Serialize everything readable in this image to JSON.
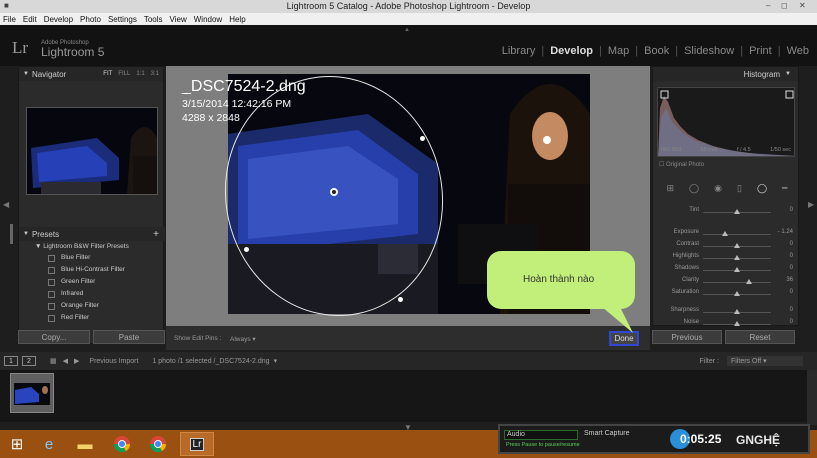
{
  "window": {
    "title": "Lightroom 5 Catalog - Adobe Photoshop Lightroom - Develop"
  },
  "menu": [
    "File",
    "Edit",
    "Develop",
    "Photo",
    "Settings",
    "Tools",
    "View",
    "Window",
    "Help"
  ],
  "identity": {
    "mark": "Lr",
    "adobe": "Adobe Photoshop",
    "name": "Lightroom 5"
  },
  "modules": [
    {
      "label": "Library",
      "active": false
    },
    {
      "label": "Develop",
      "active": true
    },
    {
      "label": "Map",
      "active": false
    },
    {
      "label": "Book",
      "active": false
    },
    {
      "label": "Slideshow",
      "active": false
    },
    {
      "label": "Print",
      "active": false
    },
    {
      "label": "Web",
      "active": false
    }
  ],
  "navigator": {
    "title": "Navigator",
    "options": [
      "FIT",
      "FILL",
      "1:1",
      "3:1"
    ],
    "active_option": "FIT"
  },
  "presets": {
    "title": "Presets",
    "add": "+",
    "folder": "Lightroom B&W Filter Presets",
    "items": [
      "Blue Filter",
      "Blue Hi-Contrast Filter",
      "Green Filter",
      "Infrared",
      "Orange Filter",
      "Red Filter"
    ]
  },
  "left_buttons": {
    "copy": "Copy...",
    "paste": "Paste"
  },
  "photo_info": {
    "filename": "_DSC7524-2.dng",
    "date": "3/15/2014 12:42:16 PM",
    "size": "4288 x 2848"
  },
  "toolbar": {
    "show_pins_label": "Show Edit Pins :",
    "show_pins_value": "Always",
    "done": "Done"
  },
  "histogram": {
    "title": "Histogram",
    "info": [
      "ISO 800",
      "50 mm",
      "f / 4.5",
      "1/50 sec"
    ],
    "original_photo": "Original Photo"
  },
  "adjustments": [
    {
      "label": "Tint",
      "value": "0",
      "level": 0.5
    },
    {
      "label": "Exposure",
      "value": "- 1.24",
      "level": 0.33
    },
    {
      "label": "Contrast",
      "value": "0",
      "level": 0.5
    },
    {
      "label": "Highlights",
      "value": "0",
      "level": 0.5
    },
    {
      "label": "Shadows",
      "value": "0",
      "level": 0.5
    },
    {
      "label": "Clarity",
      "value": "36",
      "level": 0.68
    },
    {
      "label": "Saturation",
      "value": "0",
      "level": 0.5
    },
    {
      "label": "Sharpness",
      "value": "0",
      "level": 0.5
    },
    {
      "label": "Noise",
      "value": "0",
      "level": 0.5
    }
  ],
  "right_buttons": {
    "previous": "Previous",
    "reset": "Reset"
  },
  "filmstrip": {
    "page1": "1",
    "page2": "2",
    "source": "Previous Import",
    "selection": "1 photo /1 selected /_DSC7524-2.dng",
    "filter_label": "Filter :",
    "filter_value": "Filters Off"
  },
  "callout": {
    "text": "Hoàn thành nào"
  },
  "recorder": {
    "audio": "Audio",
    "smart_capture": "Smart Capture",
    "hint": "Press Pause to pause/resume",
    "time": "0:05:25",
    "brand": "GNGHỆ"
  }
}
